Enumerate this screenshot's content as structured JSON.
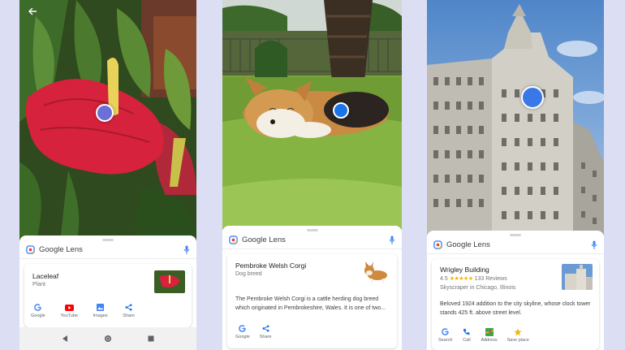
{
  "panels": [
    {
      "header": {
        "title": "Google Lens"
      },
      "result": {
        "title": "Laceleaf",
        "subtitle": "Plant"
      },
      "actions": [
        {
          "label": "Google",
          "icon": "google-icon"
        },
        {
          "label": "YouTube",
          "icon": "youtube-icon"
        },
        {
          "label": "Images",
          "icon": "images-icon"
        },
        {
          "label": "Share",
          "icon": "share-icon"
        }
      ],
      "nav": [
        "back-icon",
        "home-icon",
        "recents-icon"
      ]
    },
    {
      "header": {
        "title": "Google Lens"
      },
      "result": {
        "title": "Pembroke Welsh Corgi",
        "subtitle": "Dog breed",
        "description": "The Pembroke Welsh Corgi is a cattle herding dog breed which originated in Pembrokeshire, Wales. It is one of two..."
      },
      "actions": [
        {
          "label": "Google",
          "icon": "google-icon"
        },
        {
          "label": "Share",
          "icon": "share-icon"
        }
      ]
    },
    {
      "header": {
        "title": "Google Lens"
      },
      "result": {
        "title": "Wrigley Building",
        "rating": "4.5",
        "stars": "★★★★★",
        "reviews": "133 Reviews",
        "subtitle": "Skyscraper in Chicago, Illinois",
        "description": "Beloved 1924 addition to the city skyline, whose clock tower stands 425 ft. above street level."
      },
      "actions": [
        {
          "label": "Search",
          "icon": "google-icon"
        },
        {
          "label": "Call",
          "icon": "phone-icon"
        },
        {
          "label": "Address",
          "icon": "map-icon"
        },
        {
          "label": "Save place",
          "icon": "star-icon"
        }
      ]
    }
  ],
  "colors": {
    "background": "#dcdff3",
    "lens_blue": "#4285f4",
    "dot_purple": "#6b6fd6",
    "dot_blue": "#1a73e8"
  }
}
